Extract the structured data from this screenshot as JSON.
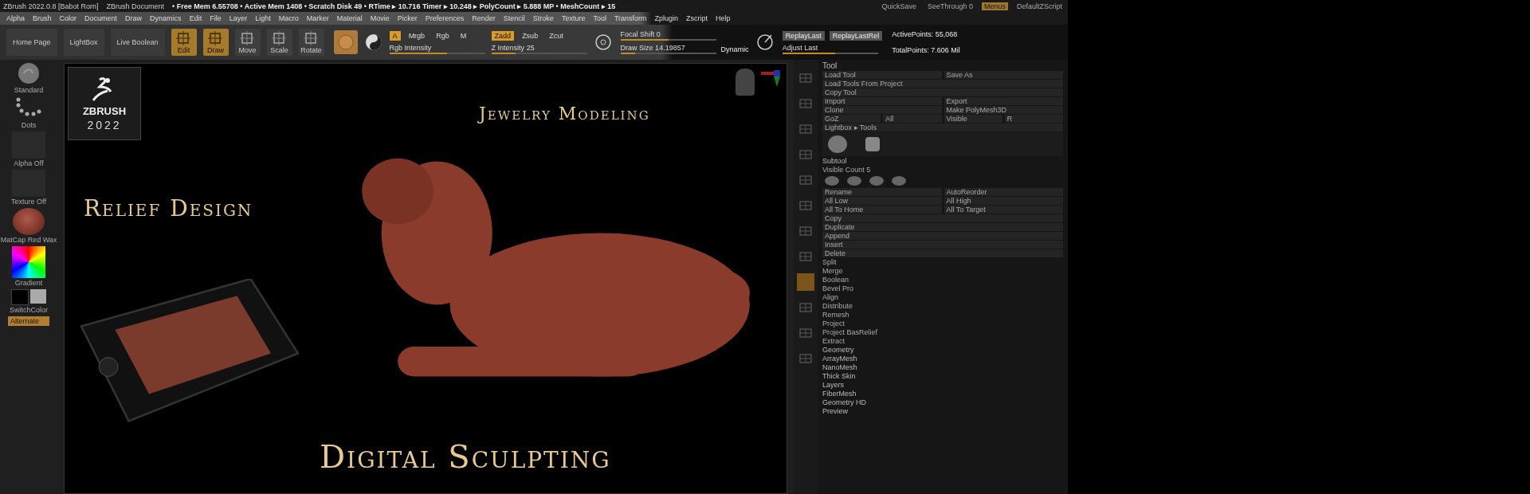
{
  "title_bar": {
    "app": "ZBrush 2022.0.8 [Babot Rorn]",
    "document": "ZBrush Document",
    "stats": "• Free Mem 6.55708 • Active Mem 1408 • Scratch Disk 49 • RTime ▸ 10.716 Timer ▸ 10.248 ▸ PolyCount ▸ 5.888 MP • MeshCount ▸ 15",
    "right": [
      {
        "label": "QuickSave",
        "selected": false
      },
      {
        "label": "SeeThrough 0",
        "selected": false
      },
      {
        "label": "Menus",
        "selected": true
      },
      {
        "label": "DefaultZScript",
        "selected": false
      }
    ]
  },
  "menu": [
    "Alpha",
    "Brush",
    "Color",
    "Document",
    "Draw",
    "Dynamics",
    "Edit",
    "File",
    "Layer",
    "Light",
    "Macro",
    "Marker",
    "Material",
    "Movie",
    "Picker",
    "Preferences",
    "Render",
    "Stencil",
    "Stroke",
    "Texture",
    "Tool",
    "Transform",
    "Zplugin",
    "Zscript",
    "Help"
  ],
  "toolbar": {
    "nav": [
      "Home Page",
      "LightBox",
      "Live Boolean"
    ],
    "tools": [
      {
        "label": "Edit",
        "selected": true
      },
      {
        "label": "Draw",
        "selected": true
      },
      {
        "label": "Move",
        "selected": false
      },
      {
        "label": "Scale",
        "selected": false
      },
      {
        "label": "Rotate",
        "selected": false
      }
    ],
    "channels": [
      {
        "label": "A",
        "selected": true
      },
      {
        "label": "Mrgb",
        "selected": false
      },
      {
        "label": "Rgb",
        "selected": false
      },
      {
        "label": "M",
        "selected": false
      }
    ],
    "depth": [
      {
        "label": "Zadd",
        "selected": true
      },
      {
        "label": "Zsub",
        "selected": false
      },
      {
        "label": "Zcut",
        "selected": false
      }
    ],
    "rgb_intensity": {
      "label": "Rgb Intensity",
      "level": 0.6
    },
    "z_intensity": {
      "label": "Z Intensity 25",
      "level": 0.25
    },
    "focal_shift": {
      "label": "Focal Shift 0",
      "level": 0.5
    },
    "draw_size": {
      "label": "Draw Size 14.19857",
      "level": 0.15
    },
    "dynamic": "Dynamic",
    "replay": [
      "ReplayLast",
      "ReplayLastRel"
    ],
    "adjust_last": {
      "label": "Adjust Last",
      "level": 0.55
    },
    "active_points": "ActivePoints: 55,068",
    "total_points": "TotalPoints: 7.606 Mil"
  },
  "left_shelf": [
    {
      "kind": "brush",
      "label": "Standard"
    },
    {
      "kind": "stroke",
      "label": "Dots"
    },
    {
      "kind": "empty",
      "label": "Alpha Off"
    },
    {
      "kind": "empty",
      "label": "Texture Off"
    },
    {
      "kind": "material",
      "label": "MatCap Red Wax"
    },
    {
      "kind": "picker",
      "label": "Gradient"
    },
    {
      "kind": "swatches",
      "label": "SwitchColor"
    },
    {
      "kind": "toggle",
      "label": "Alternate"
    }
  ],
  "canvas": {
    "logo": {
      "name": "ZBRUSH",
      "year": "2022"
    },
    "headings": [
      "Jewelry Modeling",
      "Relief Design",
      "Digital Sculpting"
    ]
  },
  "tool_panel": {
    "title": "Tool",
    "rows": [
      [
        "Load Tool",
        "Save As"
      ],
      [
        "Load Tools From Project"
      ],
      [
        "Copy Tool"
      ],
      [
        "Import",
        "Export"
      ],
      [
        "Clone",
        "Make PolyMesh3D"
      ],
      [
        "GoZ",
        "All",
        "Visible",
        "R"
      ],
      [
        "Lightbox ▸ Tools"
      ]
    ],
    "subtool": "Subtool",
    "visible_count": "Visible Count 5",
    "subtool_rows": [
      [
        "Rename",
        "AutoReorder"
      ],
      [
        "All Low",
        "All High"
      ],
      [
        "All To Home",
        "All To Target"
      ],
      [
        "Copy"
      ],
      [
        "Duplicate"
      ],
      [
        "Append"
      ],
      [
        "Insert"
      ],
      [
        "Delete"
      ]
    ],
    "sections": [
      "Split",
      "Merge",
      "Boolean",
      "Bevel Pro",
      "Align",
      "Distribute",
      "Remesh",
      "Project",
      "Project BasRelief",
      "Extract"
    ],
    "palettes": [
      "Geometry",
      "ArrayMesh",
      "NanoMesh",
      "Thick Skin",
      "Layers",
      "FiberMesh",
      "Geometry HD",
      "Preview"
    ]
  },
  "right_shelf": [
    {
      "selected": false
    },
    {
      "selected": false
    },
    {
      "selected": false
    },
    {
      "selected": false
    },
    {
      "selected": false
    },
    {
      "selected": false
    },
    {
      "selected": false
    },
    {
      "selected": false
    },
    {
      "selected": true
    },
    {
      "selected": false
    },
    {
      "selected": false
    },
    {
      "selected": false
    }
  ]
}
